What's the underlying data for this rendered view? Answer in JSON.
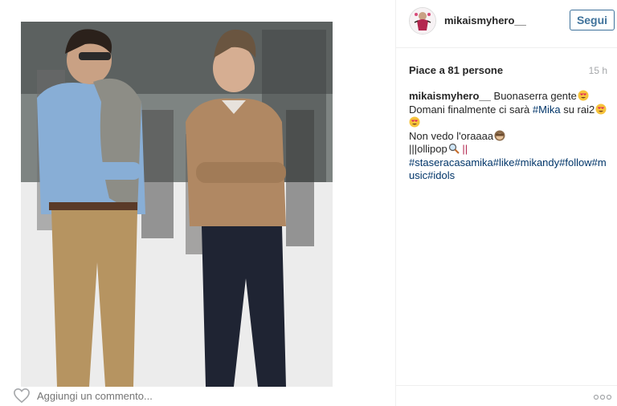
{
  "post": {
    "username": "mikaismyhero__",
    "follow_label": "Segui",
    "likes_text": "Piace a 81 persone",
    "time_ago": "15 h",
    "caption": {
      "user": "mikaismyhero__",
      "line1_text": "Buonaserra gente",
      "line2_a": "Domani finalmente ci sarà ",
      "line2_tag": "#Mika",
      "line2_b": " su rai2",
      "line4_text": "Non vedo l'oraaaa",
      "line5_a": "|||ollipop",
      "line5_b": "||",
      "hashtags_line1": "#staseracasamika#like#mikandy#follow#m",
      "hashtags_line2": "usic#idols"
    },
    "comment_placeholder": "Aggiungi un commento..."
  },
  "icons": {
    "avatar": "user-avatar",
    "heart": "heart-icon",
    "more": "more-options-icon",
    "emoji_heart_eyes": "heart-eyes-emoji-icon",
    "emoji_hide": "see-no-evil-emoji-icon",
    "emoji_magnifier": "magnifier-emoji-icon"
  },
  "colors": {
    "link": "#003569",
    "follow": "#3f729b",
    "muted": "#a5a7aa",
    "text": "#262626"
  }
}
